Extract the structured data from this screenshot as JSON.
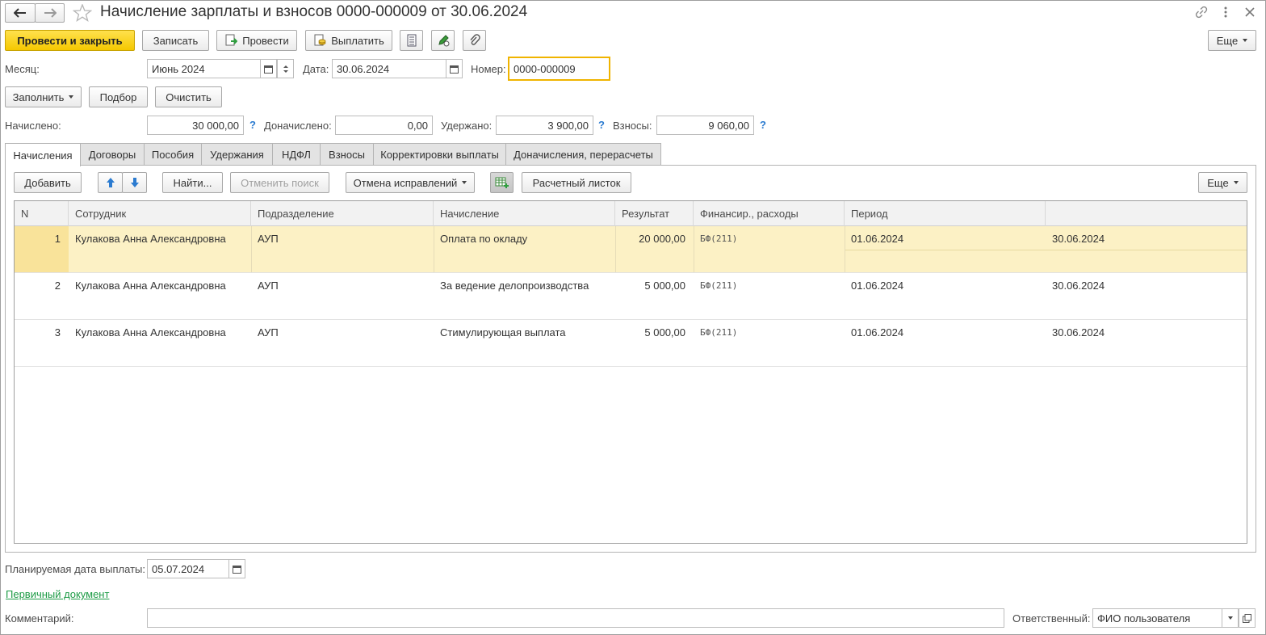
{
  "window": {
    "title": "Начисление зарплаты и взносов 0000-000009 от 30.06.2024"
  },
  "toolbar": {
    "post_close": "Провести и закрыть",
    "save": "Записать",
    "post": "Провести",
    "pay": "Выплатить",
    "more": "Еще"
  },
  "header": {
    "month_label": "Месяц:",
    "month_value": "Июнь 2024",
    "date_label": "Дата:",
    "date_value": "30.06.2024",
    "number_label": "Номер:",
    "number_value": "0000-000009"
  },
  "actions": {
    "fill": "Заполнить",
    "select": "Подбор",
    "clear": "Очистить"
  },
  "totals": {
    "accrued_label": "Начислено:",
    "accrued_value": "30 000,00",
    "additional_label": "Доначислено:",
    "additional_value": "0,00",
    "withheld_label": "Удержано:",
    "withheld_value": "3 900,00",
    "contrib_label": "Взносы:",
    "contrib_value": "9 060,00",
    "help": "?"
  },
  "tabs": [
    {
      "label": "Начисления",
      "active": true
    },
    {
      "label": "Договоры"
    },
    {
      "label": "Пособия"
    },
    {
      "label": "Удержания"
    },
    {
      "label": "НДФЛ"
    },
    {
      "label": "Взносы"
    },
    {
      "label": "Корректировки выплаты"
    },
    {
      "label": "Доначисления, перерасчеты"
    }
  ],
  "table_toolbar": {
    "add": "Добавить",
    "find": "Найти...",
    "cancel_search": "Отменить поиск",
    "cancel_fixes": "Отмена исправлений",
    "payslip": "Расчетный листок",
    "more": "Еще"
  },
  "table": {
    "columns": [
      "N",
      "Сотрудник",
      "Подразделение",
      "Начисление",
      "Результат",
      "Финансир., расходы",
      "Период",
      ""
    ],
    "rows": [
      {
        "n": "1",
        "employee": "Кулакова Анна Александровна",
        "dept": "АУП",
        "accrual": "Оплата по окладу",
        "result": "20 000,00",
        "fin": "БФ(211)",
        "from": "01.06.2024",
        "to": "30.06.2024",
        "selected": true
      },
      {
        "n": "2",
        "employee": "Кулакова Анна Александровна",
        "dept": "АУП",
        "accrual": "За ведение делопроизводства",
        "result": "5 000,00",
        "fin": "БФ(211)",
        "from": "01.06.2024",
        "to": "30.06.2024"
      },
      {
        "n": "3",
        "employee": "Кулакова Анна Александровна",
        "dept": "АУП",
        "accrual": "Стимулирующая выплата",
        "result": "5 000,00",
        "fin": "БФ(211)",
        "from": "01.06.2024",
        "to": "30.06.2024"
      }
    ]
  },
  "footer": {
    "pay_date_label": "Планируемая дата выплаты:",
    "pay_date_value": "05.07.2024",
    "primary_doc_link": "Первичный документ",
    "comment_label": "Комментарий:",
    "comment_value": "",
    "responsible_label": "Ответственный:",
    "responsible_value": "ФИО пользователя"
  },
  "colors": {
    "primary_button": "#f5c800",
    "selected_row": "#fcf1c5",
    "focus_border": "#f0b400",
    "link": "#1c9b45",
    "help": "#2b7bd0"
  }
}
